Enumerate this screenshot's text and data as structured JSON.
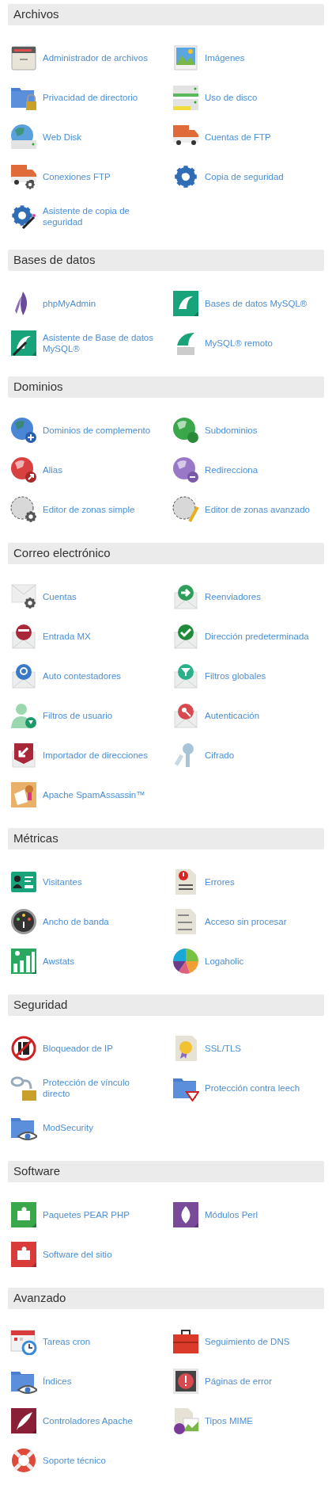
{
  "sections": [
    {
      "title": "Archivos",
      "items": [
        {
          "label": "Administrador de archivos"
        },
        {
          "label": "Imágenes"
        },
        {
          "label": "Privacidad de directorio"
        },
        {
          "label": "Uso de disco"
        },
        {
          "label": "Web Disk"
        },
        {
          "label": "Cuentas de FTP"
        },
        {
          "label": "Conexiones FTP"
        },
        {
          "label": "Copia de seguridad"
        },
        {
          "label": "Asistente de copia de seguridad"
        }
      ]
    },
    {
      "title": "Bases de datos",
      "items": [
        {
          "label": "phpMyAdmin"
        },
        {
          "label": "Bases de datos MySQL®"
        },
        {
          "label": "Asistente de Base de datos MySQL®"
        },
        {
          "label": "MySQL® remoto"
        }
      ]
    },
    {
      "title": "Dominios",
      "items": [
        {
          "label": "Dominios de complemento"
        },
        {
          "label": "Subdominios"
        },
        {
          "label": "Alias"
        },
        {
          "label": "Redirecciona"
        },
        {
          "label": "Editor de zonas simple"
        },
        {
          "label": "Editor de zonas avanzado"
        }
      ]
    },
    {
      "title": "Correo electrónico",
      "items": [
        {
          "label": "Cuentas"
        },
        {
          "label": "Reenviadores"
        },
        {
          "label": "Entrada MX"
        },
        {
          "label": "Dirección predeterminada"
        },
        {
          "label": "Auto contestadores"
        },
        {
          "label": "Filtros globales"
        },
        {
          "label": "Filtros de usuario"
        },
        {
          "label": "Autenticación"
        },
        {
          "label": "Importador de direcciones"
        },
        {
          "label": "Cifrado"
        },
        {
          "label": "Apache SpamAssassin™"
        }
      ]
    },
    {
      "title": "Métricas",
      "items": [
        {
          "label": "Visitantes"
        },
        {
          "label": "Errores"
        },
        {
          "label": "Ancho de banda"
        },
        {
          "label": "Acceso sin procesar"
        },
        {
          "label": "Awstats"
        },
        {
          "label": "Logaholic"
        }
      ]
    },
    {
      "title": "Seguridad",
      "items": [
        {
          "label": "Bloqueador de IP"
        },
        {
          "label": "SSL/TLS"
        },
        {
          "label": "Protección de vínculo directo"
        },
        {
          "label": "Protección contra leech"
        },
        {
          "label": "ModSecurity"
        }
      ]
    },
    {
      "title": "Software",
      "items": [
        {
          "label": "Paquetes PEAR PHP"
        },
        {
          "label": "Módulos Perl"
        },
        {
          "label": "Software del sitio"
        }
      ]
    },
    {
      "title": "Avanzado",
      "items": [
        {
          "label": "Tareas cron"
        },
        {
          "label": "Seguimiento de DNS"
        },
        {
          "label": "Índices"
        },
        {
          "label": "Páginas de error"
        },
        {
          "label": "Controladores Apache"
        },
        {
          "label": "Tipos MIME"
        },
        {
          "label": "Soporte técnico"
        }
      ]
    }
  ]
}
